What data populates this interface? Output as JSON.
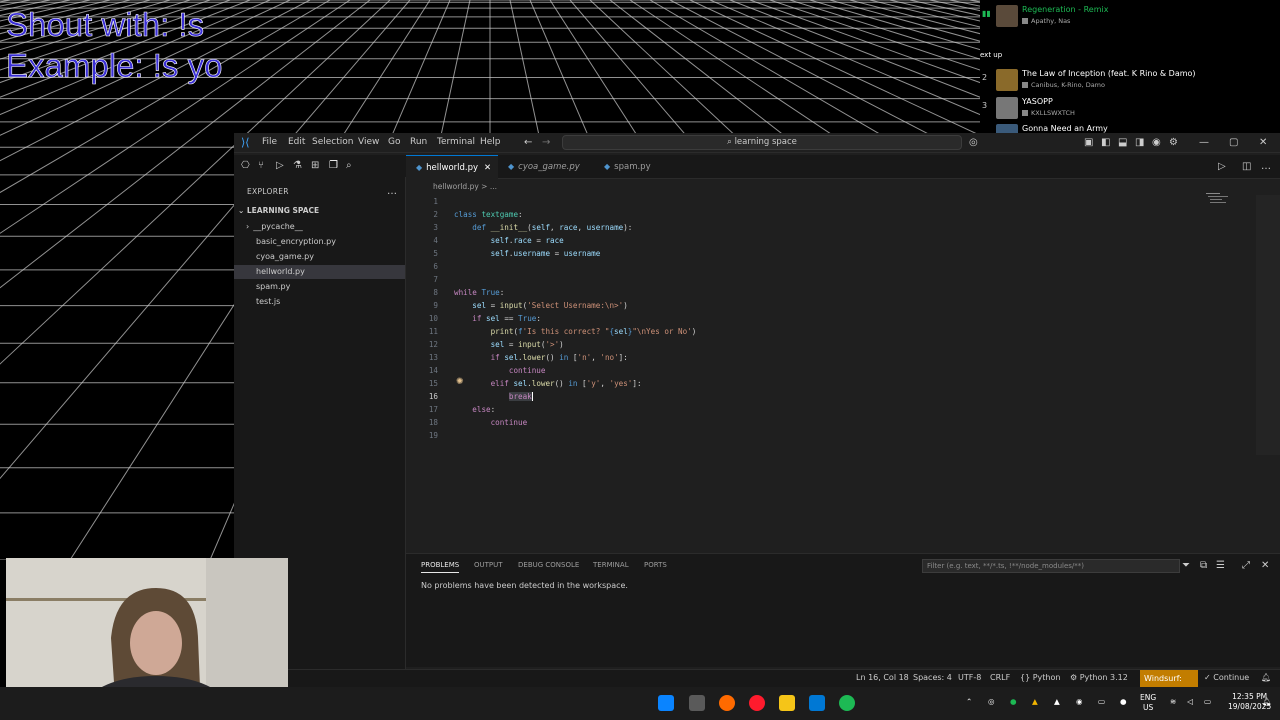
{
  "overlay": {
    "line1": "Shout with: !s",
    "line2": "Example: !s yo"
  },
  "spotify": {
    "now_playing": {
      "title": "Regeneration - Remix",
      "artist": "Apathy, Nas"
    },
    "next_up_label": "ext up",
    "queue": [
      {
        "num": "2",
        "title": "The Law of Inception (feat. K Rino & Damo)",
        "artist": "Canibus, K-Rino, Damo"
      },
      {
        "num": "3",
        "title": "YASOPP",
        "artist": "KXLLSWXTCH"
      },
      {
        "num": "",
        "title": "Gonna Need an Army",
        "artist": ""
      }
    ],
    "accent": "#1db954"
  },
  "vscode": {
    "menu": [
      "File",
      "Edit",
      "Selection",
      "View",
      "Go",
      "Run",
      "Terminal",
      "Help"
    ],
    "search": "learning space",
    "explorer_title": "EXPLORER",
    "project": "LEARNING SPACE",
    "files": [
      "__pycache__",
      "basic_encryption.py",
      "cyoa_game.py",
      "hellworld.py",
      "spam.py",
      "test.js"
    ],
    "selected_file": "hellworld.py",
    "tabs": [
      "hellworld.py",
      "cyoa_game.py",
      "spam.py"
    ],
    "breadcrumb": "hellworld.py > ...",
    "panel_tabs": [
      "PROBLEMS",
      "OUTPUT",
      "DEBUG CONSOLE",
      "TERMINAL",
      "PORTS"
    ],
    "problems_msg": "No problems have been detected in the workspace.",
    "filter_placeholder": "Filter (e.g. text, **/*.ts, !**/node_modules/**)",
    "status": {
      "position": "Ln 16, Col 18",
      "spaces": "Spaces: 4",
      "encoding": "UTF-8",
      "eol": "CRLF",
      "language": "Python",
      "interpreter": "Python 3.12",
      "windsurf": "Windsurf: {...}",
      "continue": "Continue"
    },
    "accent": "#0078d4"
  },
  "taskbar": {
    "lang": "ENG",
    "region": "US",
    "time": "12:35 PM",
    "date": "19/08/2025"
  }
}
